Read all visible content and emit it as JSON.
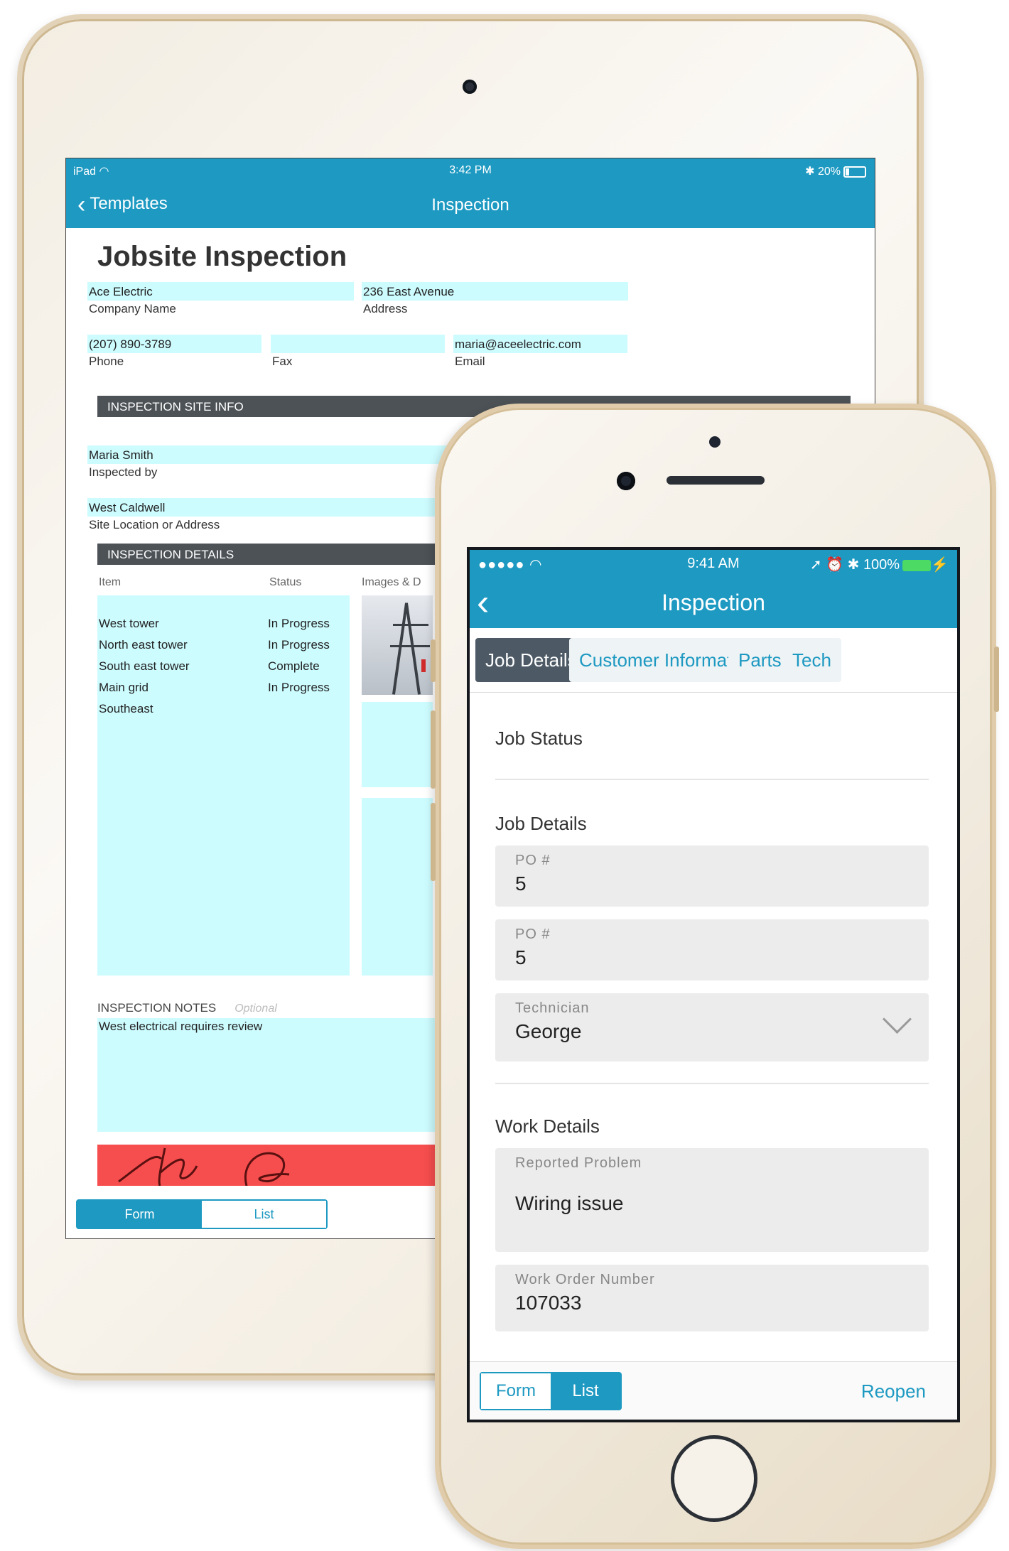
{
  "ipad": {
    "status": {
      "device": "iPad",
      "time": "3:42 PM",
      "battery": "20%",
      "battery_level": 0.2
    },
    "nav": {
      "back_label": "Templates",
      "title": "Inspection"
    },
    "doc_title": "Jobsite Inspection",
    "company": {
      "value": "Ace Electric",
      "label": "Company Name"
    },
    "address": {
      "value": "236 East Avenue",
      "label": "Address"
    },
    "phone": {
      "value": "(207) 890-3789",
      "label": "Phone"
    },
    "fax": {
      "value": "",
      "label": "Fax"
    },
    "email": {
      "value": "maria@aceelectric.com",
      "label": "Email"
    },
    "site_info_header": "INSPECTION SITE INFO",
    "inspected_by": {
      "value": "Maria Smith",
      "label": "Inspected by"
    },
    "site_location": {
      "value": "West Caldwell",
      "label": "Site Location or Address"
    },
    "details_header": "INSPECTION DETAILS",
    "columns": {
      "item": "Item",
      "status": "Status",
      "images": "Images & D"
    },
    "rows": [
      {
        "item": "West tower",
        "status": "In Progress"
      },
      {
        "item": "North east tower",
        "status": "In Progress"
      },
      {
        "item": "South east tower",
        "status": "Complete"
      },
      {
        "item": "Main grid",
        "status": "In Progress"
      },
      {
        "item": "Southeast",
        "status": ""
      }
    ],
    "notes_label": "INSPECTION NOTES",
    "notes_optional": "Optional",
    "notes_value": "West electrical requires review",
    "segments": {
      "form": "Form",
      "list": "List"
    }
  },
  "iphone": {
    "status": {
      "carrier": "●●●●●",
      "time": "9:41 AM",
      "battery": "100%"
    },
    "nav": {
      "title": "Inspection"
    },
    "tabs": [
      "Job Details",
      "Customer Information",
      "Parts",
      "Tech"
    ],
    "job_status_label": "Job Status",
    "job_details_label": "Job Details",
    "po1": {
      "label": "PO #",
      "value": "5"
    },
    "po2": {
      "label": "PO #",
      "value": "5"
    },
    "technician": {
      "label": "Technician",
      "value": "George"
    },
    "work_details_label": "Work Details",
    "reported_problem": {
      "label": "Reported Problem",
      "value": "Wiring issue"
    },
    "work_order": {
      "label": "Work Order Number",
      "value": "107033"
    },
    "segments": {
      "form": "Form",
      "list": "List"
    },
    "reopen": "Reopen"
  },
  "colors": {
    "brand": "#1d99c2",
    "field_fill": "#cdfcff",
    "section_bar": "#4d5257",
    "signature_bg": "#f64e4e"
  }
}
